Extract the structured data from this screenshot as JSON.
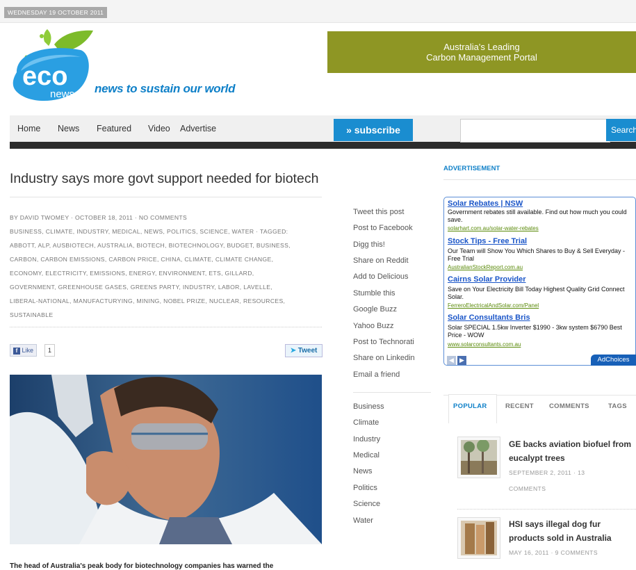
{
  "topbar": {
    "date": "WEDNESDAY 19 OCTOBER 2011"
  },
  "logo": {
    "mark": "eco",
    "sub": "news",
    "tagline": "news to sustain our world"
  },
  "banner": {
    "line1": "Australia's Leading",
    "line2": "Carbon Management Portal",
    "color": "#8e9624"
  },
  "nav": {
    "items": [
      "Home",
      "News",
      "Featured",
      "Video",
      "Advertise"
    ],
    "subscribe": "» subscribe",
    "search_placeholder": "",
    "search_button": "Search"
  },
  "article": {
    "title": "Industry says more govt support needed for biotech",
    "meta_lines": [
      "By David Twomey · October 18, 2011 · No Comments",
      "Business, Climate, Industry, Medical, News, Politics, Science, Water · Tagged:",
      "Abbott, ALP, Ausbiotech, Australia, biotech, Biotechnology, budget, business,",
      "carbon, carbon emissions, carbon price, China, climate, climate change,",
      "economy, electricity, emissions, energy, environment, ETS, Gillard,",
      "government, greenhouse gases, greens party, industry, labor, Lavelle,",
      "Liberal-National, manufacturying, mining, Nobel Prize, nuclear, resources,",
      "sustainable"
    ],
    "like_label": "Like",
    "like_count": "1",
    "tweet_label": "Tweet",
    "lede": "The head of Australia's peak body for biotechnology companies has warned the"
  },
  "share": [
    "Tweet this post",
    "Post to Facebook",
    "Digg this!",
    "Share on Reddit",
    "Add to Delicious",
    "Stumble this",
    "Google Buzz",
    "Yahoo Buzz",
    "Post to Technorati",
    "Share on Linkedin",
    "Email a friend"
  ],
  "categories": [
    "Business",
    "Climate",
    "Industry",
    "Medical",
    "News",
    "Politics",
    "Science",
    "Water"
  ],
  "sidebar": {
    "ad_label": "ADVERTISEMENT",
    "ads": [
      {
        "title": "Solar Rebates | NSW",
        "body": "Government rebates still available. Find out how much you could save.",
        "url": "solarhart.com.au/solar-water-rebates"
      },
      {
        "title": "Stock Tips - Free Trial",
        "body": "Our Team will Show You Which Shares to Buy & Sell Everyday - Free Trial",
        "url": "AustralianStockReport.com.au"
      },
      {
        "title": "Cairns Solar Provider",
        "body": "Save on Your Electricity Bill Today Highest Quality Grid Connect Solar.",
        "url": "FerreroElectricalAndSolar.com/Panel"
      },
      {
        "title": "Solar Consultants Bris",
        "body": "Solar SPECIAL 1.5kw Inverter $1990 - 3kw system $6790 Best Price - WOW",
        "url": "www.solarconsultants.com.au"
      }
    ],
    "adchoices": "AdChoices",
    "tabs": [
      "POPULAR",
      "RECENT",
      "COMMENTS",
      "TAGS"
    ],
    "popular": [
      {
        "title": "GE backs aviation biofuel from eucalypt trees",
        "meta1": "SEPTEMBER 2, 2011 · 13",
        "meta2": "COMMENTS"
      },
      {
        "title": "HSI says illegal dog fur products sold in Australia",
        "meta1": "MAY 16, 2011 · 9 COMMENTS",
        "meta2": ""
      }
    ]
  }
}
